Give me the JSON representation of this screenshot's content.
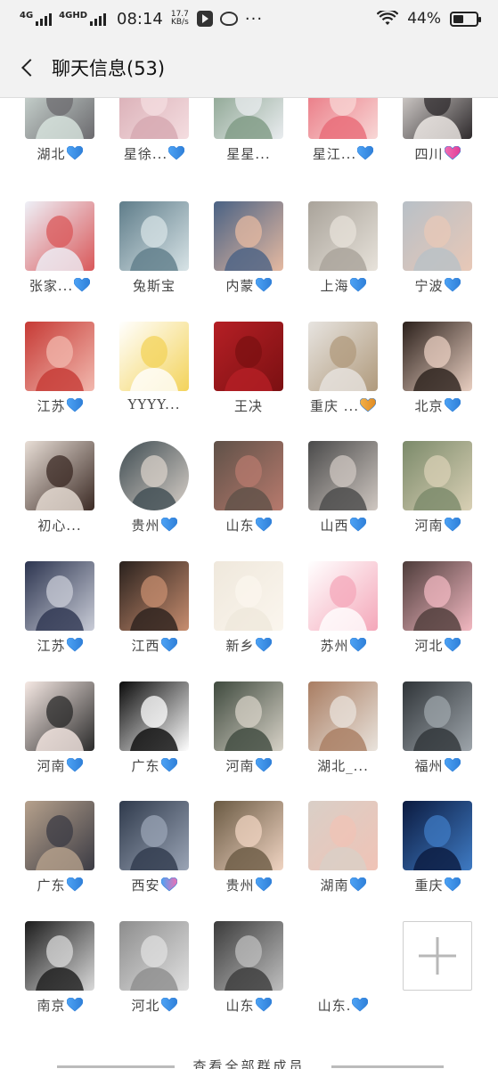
{
  "status_bar": {
    "network1": "4G",
    "network2": "4GHD",
    "time": "08:14",
    "speed_value": "17.7",
    "speed_unit": "KB/s",
    "more": "···",
    "battery_percent": "44%",
    "battery_level": 0.44,
    "icons": [
      "signal-icon",
      "video-app-icon",
      "weibo-icon",
      "wifi-icon",
      "battery-icon"
    ]
  },
  "header": {
    "back_icon": "chevron-left-icon",
    "title": "聊天信息(53)"
  },
  "members": [
    {
      "name": "湖北",
      "heart": "blue",
      "colors": [
        "#d9e6e0",
        "#6b6a6e"
      ]
    },
    {
      "name": "星徐...",
      "heart": "blue-half",
      "colors": [
        "#d6a8b0",
        "#f4dde0"
      ]
    },
    {
      "name": "星星...",
      "heart": "",
      "colors": [
        "#7e9a83",
        "#e9ecef"
      ]
    },
    {
      "name": "星江...",
      "heart": "blue-half",
      "colors": [
        "#e86a77",
        "#f8d7d6"
      ]
    },
    {
      "name": "四川",
      "heart": "pink2",
      "colors": [
        "#f1ece8",
        "#2e2a2c"
      ]
    },
    {
      "name": "张家...",
      "heart": "blue-half",
      "colors": [
        "#eef0f7",
        "#d9585a"
      ]
    },
    {
      "name": "兔斯宝",
      "heart": "",
      "colors": [
        "#5f7d8a",
        "#d7e3e6"
      ]
    },
    {
      "name": "内蒙",
      "heart": "blue",
      "colors": [
        "#4a6284",
        "#e5b9a1"
      ]
    },
    {
      "name": "上海",
      "heart": "blue",
      "colors": [
        "#a9a39a",
        "#e7e2da"
      ]
    },
    {
      "name": "宁波",
      "heart": "blue",
      "colors": [
        "#b8c0c7",
        "#e8c8b7"
      ]
    },
    {
      "name": "江苏",
      "heart": "blue",
      "colors": [
        "#c63a35",
        "#f2b8ae"
      ]
    },
    {
      "name": "YYYY...",
      "heart": "",
      "colors": [
        "#ffffff",
        "#f3d35a"
      ]
    },
    {
      "name": "王决",
      "heart": "",
      "colors": [
        "#b51f25",
        "#7b1012"
      ]
    },
    {
      "name": "重庆 ...",
      "heart": "orange-half",
      "colors": [
        "#e7e4e0",
        "#b09a7c"
      ]
    },
    {
      "name": "北京",
      "heart": "blue",
      "colors": [
        "#2b201b",
        "#e9cfc1"
      ]
    },
    {
      "name": "初心...",
      "heart": "",
      "colors": [
        "#e8ded6",
        "#3b2a24"
      ]
    },
    {
      "name": "贵州",
      "heart": "blue",
      "colors": [
        "#3f4c52",
        "#d8d0c8"
      ]
    },
    {
      "name": "山东",
      "heart": "blue",
      "colors": [
        "#5f5148",
        "#b77a6d"
      ]
    },
    {
      "name": "山西",
      "heart": "blue",
      "colors": [
        "#4a4a4a",
        "#cfc7c1"
      ]
    },
    {
      "name": "河南",
      "heart": "blue",
      "colors": [
        "#7b8a6a",
        "#d9d0b5"
      ]
    },
    {
      "name": "江苏",
      "heart": "blue",
      "colors": [
        "#2d3550",
        "#c9ccd7"
      ]
    },
    {
      "name": "江西",
      "heart": "blue",
      "colors": [
        "#2a211d",
        "#c78d6f"
      ]
    },
    {
      "name": "新乡",
      "heart": "blue",
      "colors": [
        "#efe8dc",
        "#fbf6ee"
      ]
    },
    {
      "name": "苏州",
      "heart": "blue",
      "colors": [
        "#ffffff",
        "#f4a7b9"
      ]
    },
    {
      "name": "河北",
      "heart": "blue",
      "colors": [
        "#4d3c3a",
        "#f2b8c1"
      ]
    },
    {
      "name": "河南",
      "heart": "blue",
      "colors": [
        "#f6e9e4",
        "#2a2a2a"
      ]
    },
    {
      "name": "广东",
      "heart": "blue",
      "colors": [
        "#0b0b0b",
        "#ffffff"
      ]
    },
    {
      "name": "河南",
      "heart": "blue-extra",
      "colors": [
        "#3f4a3e",
        "#d7d2c7"
      ]
    },
    {
      "name": "湖北_...",
      "heart": "",
      "colors": [
        "#a97d62",
        "#e9e3dc"
      ]
    },
    {
      "name": "福州",
      "heart": "blue",
      "colors": [
        "#2f3438",
        "#9ea5ab"
      ]
    },
    {
      "name": "广东",
      "heart": "blue",
      "colors": [
        "#b6a18c",
        "#3b3b44"
      ]
    },
    {
      "name": "西安",
      "heart": "blue-pink",
      "colors": [
        "#2f3a4c",
        "#9aa4b5"
      ]
    },
    {
      "name": "贵州",
      "heart": "blue",
      "colors": [
        "#6a5a43",
        "#f0d4c2"
      ]
    },
    {
      "name": "湖南",
      "heart": "blue",
      "colors": [
        "#d9cfc7",
        "#f0c3b6"
      ]
    },
    {
      "name": "重庆",
      "heart": "blue",
      "colors": [
        "#0b1a3f",
        "#3f7bc4"
      ]
    },
    {
      "name": "南京",
      "heart": "blue",
      "colors": [
        "#1c1c1c",
        "#d9d9d9"
      ]
    },
    {
      "name": "河北",
      "heart": "blue",
      "colors": [
        "#8d8d8d",
        "#e0e0e0"
      ]
    },
    {
      "name": "山东",
      "heart": "blue",
      "colors": [
        "#3b3b3b",
        "#bfbfbf"
      ]
    },
    {
      "name": "山东.",
      "heart": "blue",
      "colors": [],
      "no_avatar": true
    }
  ],
  "add_button": {
    "icon": "plus-icon"
  },
  "footer_link": "查看全部群成员"
}
